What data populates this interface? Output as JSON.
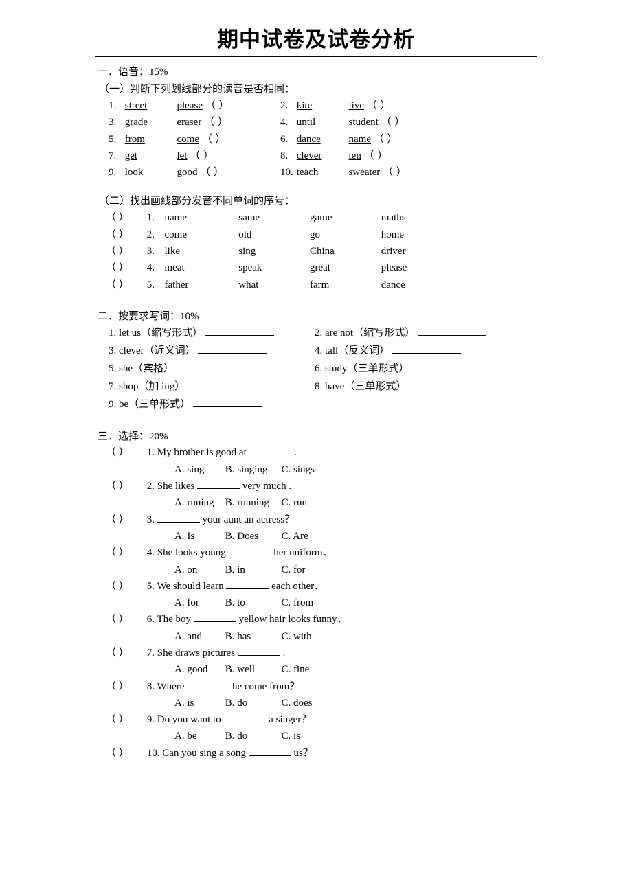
{
  "title": "期中试卷及试卷分析",
  "sections": {
    "s1": {
      "heading": "一．语音：15%",
      "part1_heading": "（一）判断下列划线部分的读音是否相同：",
      "pairs": [
        {
          "n": "1.",
          "a": "street",
          "au": "ee",
          "b": "please",
          "bu": "ea"
        },
        {
          "n": "2.",
          "a": "kite",
          "au": "i",
          "b": "live",
          "bu": "i"
        },
        {
          "n": "3.",
          "a": "grade",
          "au": "a",
          "b": "eraser",
          "bu": "a"
        },
        {
          "n": "4.",
          "a": "until",
          "au": "u",
          "b": "student",
          "bu": "u"
        },
        {
          "n": "5.",
          "a": "from",
          "au": "o",
          "b": "come",
          "bu": "o"
        },
        {
          "n": "6.",
          "a": "dance",
          "au": "a",
          "b": "name",
          "bu": "a"
        },
        {
          "n": "7.",
          "a": "get",
          "au": "e",
          "b": "let",
          "bu": "e"
        },
        {
          "n": "8.",
          "a": "clever",
          "au": "e",
          "b": "ten",
          "bu": "e"
        },
        {
          "n": "9.",
          "a": "look",
          "au": "oo",
          "b": "good",
          "bu": "oo"
        },
        {
          "n": "10.",
          "a": "teach",
          "au": "ea",
          "b": "sweater",
          "bu": "ea"
        }
      ],
      "part2_heading": "（二）找出画线部分发音不同单词的序号：",
      "choices": [
        {
          "n": "1.",
          "a": "name",
          "b": "same",
          "c": "game",
          "d": "maths"
        },
        {
          "n": "2.",
          "a": "come",
          "b": "old",
          "c": "go",
          "d": "home"
        },
        {
          "n": "3.",
          "a": "like",
          "b": "sing",
          "c": "China",
          "d": "driver"
        },
        {
          "n": "4.",
          "a": "meat",
          "b": "speak",
          "c": "great",
          "d": "please"
        },
        {
          "n": "5.",
          "a": "father",
          "b": "what",
          "c": "farm",
          "d": "dance"
        }
      ]
    },
    "s2": {
      "heading": "二．按要求写词：10%",
      "items": [
        "1. let us（缩写形式）",
        "2. are not（缩写形式）",
        "3. clever（近义词）",
        "4. tall（反义词）",
        "5. she（宾格）",
        "6. study（三单形式）",
        "7. shop（加 ing）",
        "8. have（三单形式）",
        "9. be（三单形式）"
      ]
    },
    "s3": {
      "heading": "三．选择：20%",
      "questions": [
        {
          "n": "1.",
          "text_a": "My brother is good at",
          "text_b": ".",
          "a": "A. sing",
          "b": "B. singing",
          "c": "C. sings"
        },
        {
          "n": "2.",
          "text_a": "She likes",
          "text_b": "very much .",
          "a": "A. runing",
          "b": "B. running",
          "c": "C. run"
        },
        {
          "n": "3.",
          "text_a": "",
          "text_b": "your aunt an actress？",
          "a": "A. Is",
          "b": "B. Does",
          "c": "C. Are"
        },
        {
          "n": "4.",
          "text_a": "She looks young",
          "text_b": "her uniform．",
          "a": "A. on",
          "b": "B. in",
          "c": "C. for"
        },
        {
          "n": "5.",
          "text_a": "We should learn",
          "text_b": "each other．",
          "a": "A. for",
          "b": "B. to",
          "c": "C. from"
        },
        {
          "n": "6.",
          "text_a": "The boy",
          "text_b": "yellow hair looks funny．",
          "a": "A. and",
          "b": "B. has",
          "c": "C. with"
        },
        {
          "n": "7.",
          "text_a": "She draws pictures",
          "text_b": ".",
          "a": "A. good",
          "b": "B. well",
          "c": "C. fine"
        },
        {
          "n": "8.",
          "text_a": "Where",
          "text_b": "he come from？",
          "a": "A. is",
          "b": "B. do",
          "c": "C. does"
        },
        {
          "n": "9.",
          "text_a": "Do you want to",
          "text_b": "a singer？",
          "a": "A. be",
          "b": "B. do",
          "c": "C. is"
        },
        {
          "n": "10.",
          "text_a": "Can you sing a song",
          "text_b": "us？",
          "a": "",
          "b": "",
          "c": ""
        }
      ]
    }
  },
  "markers": {
    "paren_open": "（",
    "paren_close": "）",
    "paren_empty": "（        ）"
  }
}
